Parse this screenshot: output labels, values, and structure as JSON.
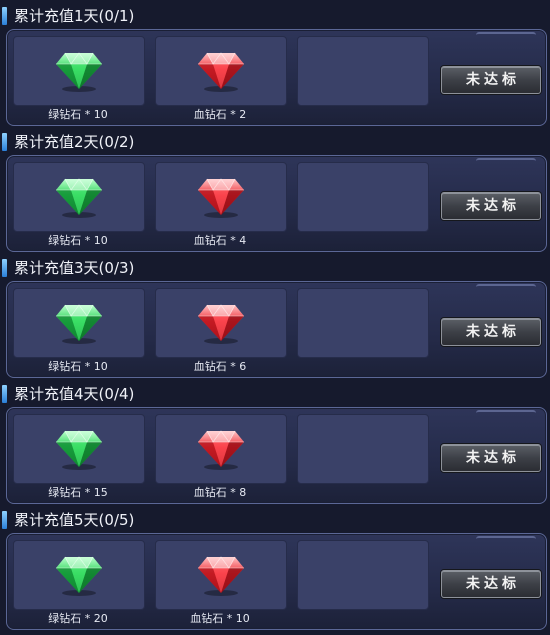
{
  "rewards": [
    {
      "title": "累计充值1天(0/1)",
      "items": [
        {
          "icon": "green-diamond",
          "label": "绿钻石 * 10"
        },
        {
          "icon": "red-diamond",
          "label": "血钻石 * 2"
        }
      ],
      "button": "未达标"
    },
    {
      "title": "累计充值2天(0/2)",
      "items": [
        {
          "icon": "green-diamond",
          "label": "绿钻石 * 10"
        },
        {
          "icon": "red-diamond",
          "label": "血钻石 * 4"
        }
      ],
      "button": "未达标"
    },
    {
      "title": "累计充值3天(0/3)",
      "items": [
        {
          "icon": "green-diamond",
          "label": "绿钻石 * 10"
        },
        {
          "icon": "red-diamond",
          "label": "血钻石 * 6"
        }
      ],
      "button": "未达标"
    },
    {
      "title": "累计充值4天(0/4)",
      "items": [
        {
          "icon": "green-diamond",
          "label": "绿钻石 * 15"
        },
        {
          "icon": "red-diamond",
          "label": "血钻石 * 8"
        }
      ],
      "button": "未达标"
    },
    {
      "title": "累计充值5天(0/5)",
      "items": [
        {
          "icon": "green-diamond",
          "label": "绿钻石 * 20"
        },
        {
          "icon": "red-diamond",
          "label": "血钻石 * 10"
        }
      ],
      "button": "未达标"
    }
  ],
  "colors": {
    "green_gem": "#2fd35a",
    "red_gem": "#f0343c",
    "accent": "#2a7fd8"
  }
}
